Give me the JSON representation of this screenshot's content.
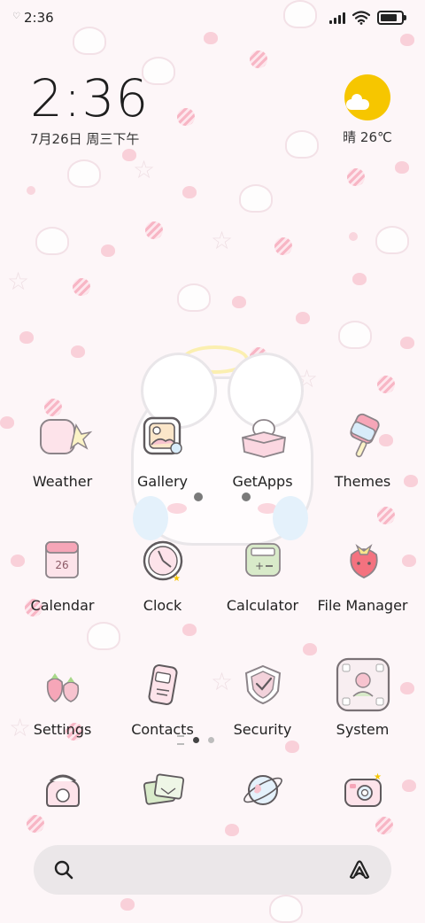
{
  "status_bar": {
    "time": "2:36",
    "notification_icon": "heart-icon",
    "signal_icon": "cellular-signal-icon",
    "wifi_icon": "wifi-icon",
    "battery_icon": "battery-icon"
  },
  "clock_widget": {
    "time": "2:36",
    "date": "7月26日 周三下午"
  },
  "weather_widget": {
    "icon": "sun-cloud-icon",
    "text": "晴 26℃"
  },
  "apps": [
    {
      "label": "Weather",
      "icon": "weather-icon"
    },
    {
      "label": "Gallery",
      "icon": "gallery-icon"
    },
    {
      "label": "GetApps",
      "icon": "getapps-icon"
    },
    {
      "label": "Themes",
      "icon": "themes-icon"
    },
    {
      "label": "Calendar",
      "icon": "calendar-icon"
    },
    {
      "label": "Clock",
      "icon": "clock-icon"
    },
    {
      "label": "Calculator",
      "icon": "calculator-icon"
    },
    {
      "label": "File Manager",
      "icon": "file-manager-icon"
    },
    {
      "label": "Settings",
      "icon": "settings-icon"
    },
    {
      "label": "Contacts",
      "icon": "contacts-icon"
    },
    {
      "label": "Security",
      "icon": "security-icon"
    },
    {
      "label": "System",
      "icon": "system-icon"
    }
  ],
  "page_indicator": {
    "pages": 2,
    "current": 1
  },
  "dock": [
    {
      "icon": "phone-icon"
    },
    {
      "icon": "messages-icon"
    },
    {
      "icon": "browser-icon"
    },
    {
      "icon": "camera-icon"
    }
  ],
  "search_bar": {
    "search_icon": "search-icon",
    "assistant_icon": "assistant-icon"
  },
  "colors": {
    "background": "#fdf6f8",
    "accent_pink": "#f6a6b8",
    "sun": "#f6c600"
  }
}
